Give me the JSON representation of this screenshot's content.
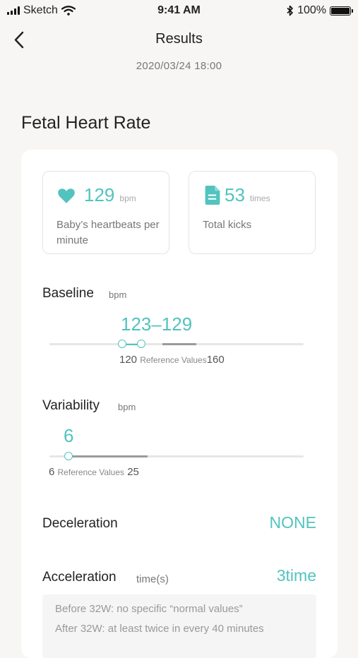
{
  "status_bar": {
    "carrier": "Sketch",
    "time": "9:41 AM",
    "battery": "100%"
  },
  "header": {
    "title": "Results",
    "datetime": "2020/03/24   18:00"
  },
  "section_title": "Fetal Heart Rate",
  "stats": [
    {
      "icon": "heart-icon",
      "value": "129",
      "unit": "bpm",
      "desc": "Baby’s heartbeats per minute"
    },
    {
      "icon": "document-icon",
      "value": "53",
      "unit": "times",
      "desc": "Total kicks"
    }
  ],
  "baseline": {
    "label": "Baseline",
    "unit": "bpm",
    "range": "123–129",
    "ref_min": "120",
    "ref_label": "Reference Values",
    "ref_max": "160",
    "low": 123,
    "high": 129,
    "scale_min": 100,
    "scale_max": 180
  },
  "variability": {
    "label": "Variability",
    "unit": "bpm",
    "value": "6",
    "ref_min": "6",
    "ref_label": "Reference Values",
    "ref_max": "25",
    "level": 6,
    "scale_min": 6,
    "scale_max": 25
  },
  "deceleration": {
    "label": "Deceleration",
    "value": "NONE"
  },
  "acceleration": {
    "label": "Acceleration",
    "unit": "time(s)",
    "value": "3time"
  },
  "note": {
    "line1": "Before 32W: no specific “normal values”",
    "line2": "After 32W: at least twice in every 40 minutes"
  },
  "colors": {
    "accent": "#52c3bf",
    "background": "#f7f6f4",
    "card": "#ffffff"
  }
}
